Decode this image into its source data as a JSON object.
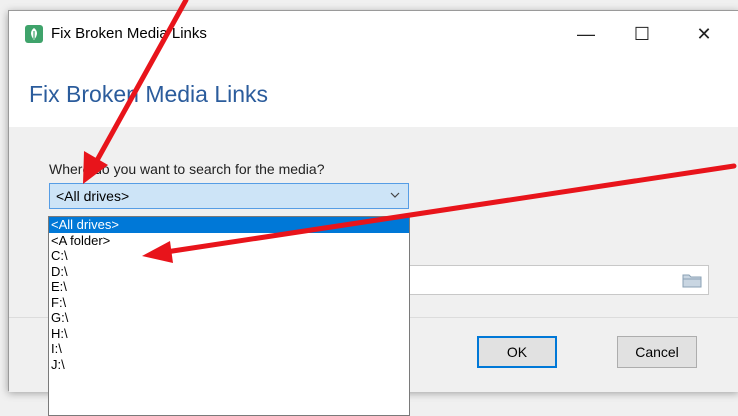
{
  "window": {
    "title": "Fix Broken Media Links",
    "controls": {
      "minimize": "—",
      "maximize": "☐",
      "close": "✕"
    }
  },
  "header": {
    "title": "Fix Broken Media Links"
  },
  "search": {
    "prompt": "Where do you want to search for the media?",
    "selected": "<All drives>"
  },
  "dropdown": {
    "options": [
      "<All drives>",
      "<A folder>",
      "C:\\",
      "D:\\",
      "E:\\",
      "F:\\",
      "G:\\",
      "H:\\",
      "I:\\",
      "J:\\"
    ],
    "highlighted_index": 0
  },
  "buttons": {
    "ok": "OK",
    "cancel": "Cancel"
  },
  "colors": {
    "accent": "#0078d7",
    "header_text": "#2b5c9c",
    "annotation_arrow": "#e8141b"
  },
  "icons": [
    "app-icon",
    "chevron-down-icon",
    "folder-icon",
    "minimize-icon",
    "maximize-icon",
    "close-icon"
  ]
}
